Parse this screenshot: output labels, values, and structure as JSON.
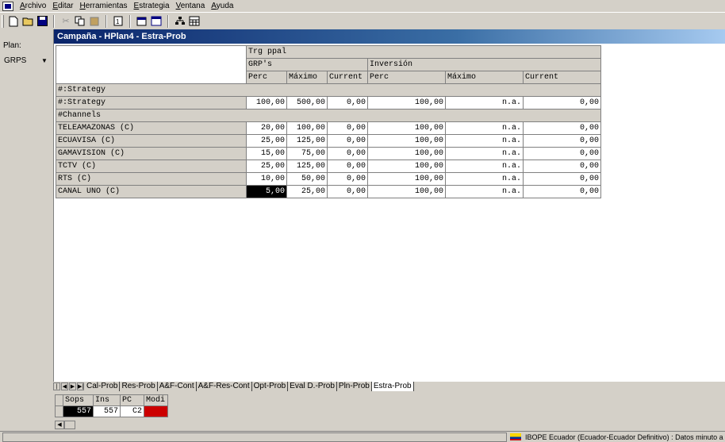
{
  "menu": [
    "Archivo",
    "Editar",
    "Herramientas",
    "Estrategia",
    "Ventana",
    "Ayuda"
  ],
  "toolbar": {
    "icons": [
      "new-icon",
      "open-icon",
      "save-icon",
      "cut-icon",
      "copy-icon",
      "paste-icon",
      "report-icon",
      "properties-icon",
      "window-icon",
      "hierarchy-icon",
      "calculator-icon"
    ]
  },
  "leftpanel": {
    "plan_label": "Plan:",
    "plan_value": "GRPS"
  },
  "window": {
    "title": "Campaña - HPlan4 - Estra-Prob"
  },
  "grid": {
    "target": "Trg ppal",
    "group1": "GRP's",
    "group2": "Inversión",
    "cols": [
      "Perc",
      "Máximo",
      "Current",
      "Perc",
      "Máximo",
      "Current"
    ],
    "section1": "#:Strategy",
    "strategy_row": {
      "label": "#:Strategy",
      "values": [
        "100,00",
        "500,00",
        "0,00",
        "100,00",
        "n.a.",
        "0,00"
      ]
    },
    "section2": "#Channels",
    "rows": [
      {
        "label": "TELEAMAZONAS (C)",
        "values": [
          "20,00",
          "100,00",
          "0,00",
          "100,00",
          "n.a.",
          "0,00"
        ]
      },
      {
        "label": "ECUAVISA (C)",
        "values": [
          "25,00",
          "125,00",
          "0,00",
          "100,00",
          "n.a.",
          "0,00"
        ]
      },
      {
        "label": "GAMAVISION (C)",
        "values": [
          "15,00",
          "75,00",
          "0,00",
          "100,00",
          "n.a.",
          "0,00"
        ]
      },
      {
        "label": "TCTV (C)",
        "values": [
          "25,00",
          "125,00",
          "0,00",
          "100,00",
          "n.a.",
          "0,00"
        ]
      },
      {
        "label": "RTS (C)",
        "values": [
          "10,00",
          "50,00",
          "0,00",
          "100,00",
          "n.a.",
          "0,00"
        ]
      },
      {
        "label": "CANAL UNO  (C)",
        "values": [
          "5,00",
          "25,00",
          "0,00",
          "100,00",
          "n.a.",
          "0,00"
        ]
      }
    ]
  },
  "tabs": [
    "Cal-Prob",
    "Res-Prob",
    "A&F-Cont",
    "A&F-Res-Cont",
    "Opt-Prob",
    "Eval D.-Prob",
    "Pln-Prob",
    "Estra-Prob"
  ],
  "active_tab": "Estra-Prob",
  "mini": {
    "headers": [
      "Sops",
      "Ins",
      "PC",
      "Modi"
    ],
    "values": [
      "557",
      "557",
      "C2",
      ""
    ]
  },
  "status": {
    "text": "IBOPE Ecuador (Ecuador-Ecuador Definitivo) : Datos minuto a minuto"
  }
}
